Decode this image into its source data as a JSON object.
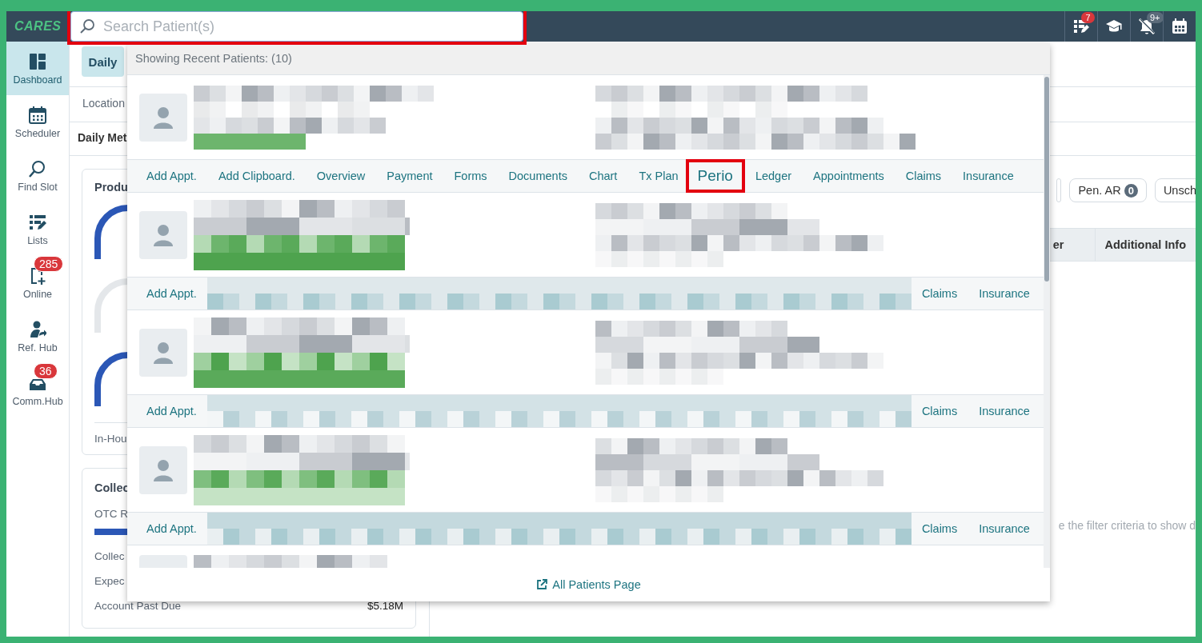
{
  "topbar": {
    "logo": "CARES",
    "search": {
      "placeholder": "Search Patient(s)",
      "highlighted": true
    },
    "icons": [
      {
        "kind": "tasks",
        "badge": "7",
        "color": "#d9373b"
      },
      {
        "kind": "learning"
      },
      {
        "kind": "notifications-off",
        "badge": "9+",
        "color": "#5b6b7a"
      },
      {
        "kind": "calendar"
      }
    ]
  },
  "sidebar": {
    "items": [
      {
        "label": "Dashboard",
        "kind": "dashboard",
        "selected": true
      },
      {
        "label": "Scheduler",
        "kind": "scheduler",
        "selected": false
      },
      {
        "label": "Find Slot",
        "kind": "find-slot",
        "selected": false
      },
      {
        "label": "Lists",
        "kind": "lists",
        "selected": false
      },
      {
        "label": "Online",
        "kind": "online",
        "selected": false,
        "badge": "285"
      },
      {
        "label": "Ref. Hub",
        "kind": "ref-hub",
        "selected": false
      },
      {
        "label": "Comm.Hub",
        "kind": "comm-hub",
        "selected": false,
        "badge": "36"
      }
    ]
  },
  "dashboard": {
    "tab": {
      "label": "Daily",
      "selected": true
    },
    "location_label": "Location",
    "section_title": "Daily Met",
    "production_card": {
      "title": "Produ",
      "footer": "In-Hou"
    },
    "collections_card": {
      "title": "Collec",
      "subtitle": "OTC R",
      "rows": [
        {
          "label": "Collec"
        },
        {
          "label": "Expec"
        },
        {
          "label": "Account Past Due",
          "value": "$5.18M"
        }
      ]
    },
    "filters": [
      {
        "label": "Pen. AR",
        "count": "0"
      },
      {
        "label": "Unsch"
      }
    ],
    "table": {
      "columns": [
        "er",
        "Additional Info"
      ]
    },
    "empty_message": "e the filter criteria to show d"
  },
  "patient_search": {
    "header": "Showing Recent Patients:  (10)",
    "patients": [
      {
        "kind": "full",
        "actions": [
          {
            "label": "Add Appt.",
            "highlighted": false
          },
          {
            "label": "Add Clipboard.",
            "highlighted": false
          },
          {
            "label": "Overview",
            "highlighted": false
          },
          {
            "label": "Payment",
            "highlighted": false
          },
          {
            "label": "Forms",
            "highlighted": false
          },
          {
            "label": "Documents",
            "highlighted": false
          },
          {
            "label": "Chart",
            "highlighted": false
          },
          {
            "label": "Tx Plan",
            "highlighted": false
          },
          {
            "label": "Perio",
            "highlighted": true
          },
          {
            "label": "Ledger",
            "highlighted": false
          },
          {
            "label": "Appointments",
            "highlighted": false
          },
          {
            "label": "Claims",
            "highlighted": false
          },
          {
            "label": "Insurance",
            "highlighted": false
          }
        ]
      },
      {
        "kind": "obscured",
        "actions": [
          {
            "label": "Add Appt.",
            "highlighted": false
          },
          {
            "label": "Claims",
            "highlighted": false
          },
          {
            "label": "Insurance",
            "highlighted": false
          }
        ]
      },
      {
        "kind": "obscured",
        "actions": [
          {
            "label": "Add Appt.",
            "highlighted": false
          },
          {
            "label": "Claims",
            "highlighted": false
          },
          {
            "label": "Insurance",
            "highlighted": false
          }
        ]
      },
      {
        "kind": "obscured",
        "actions": [
          {
            "label": "Add Appt.",
            "highlighted": false
          },
          {
            "label": "Claims",
            "highlighted": false
          },
          {
            "label": "Insurance",
            "highlighted": false
          }
        ]
      },
      {
        "kind": "partial"
      }
    ],
    "footer_link": "All Patients Page"
  }
}
